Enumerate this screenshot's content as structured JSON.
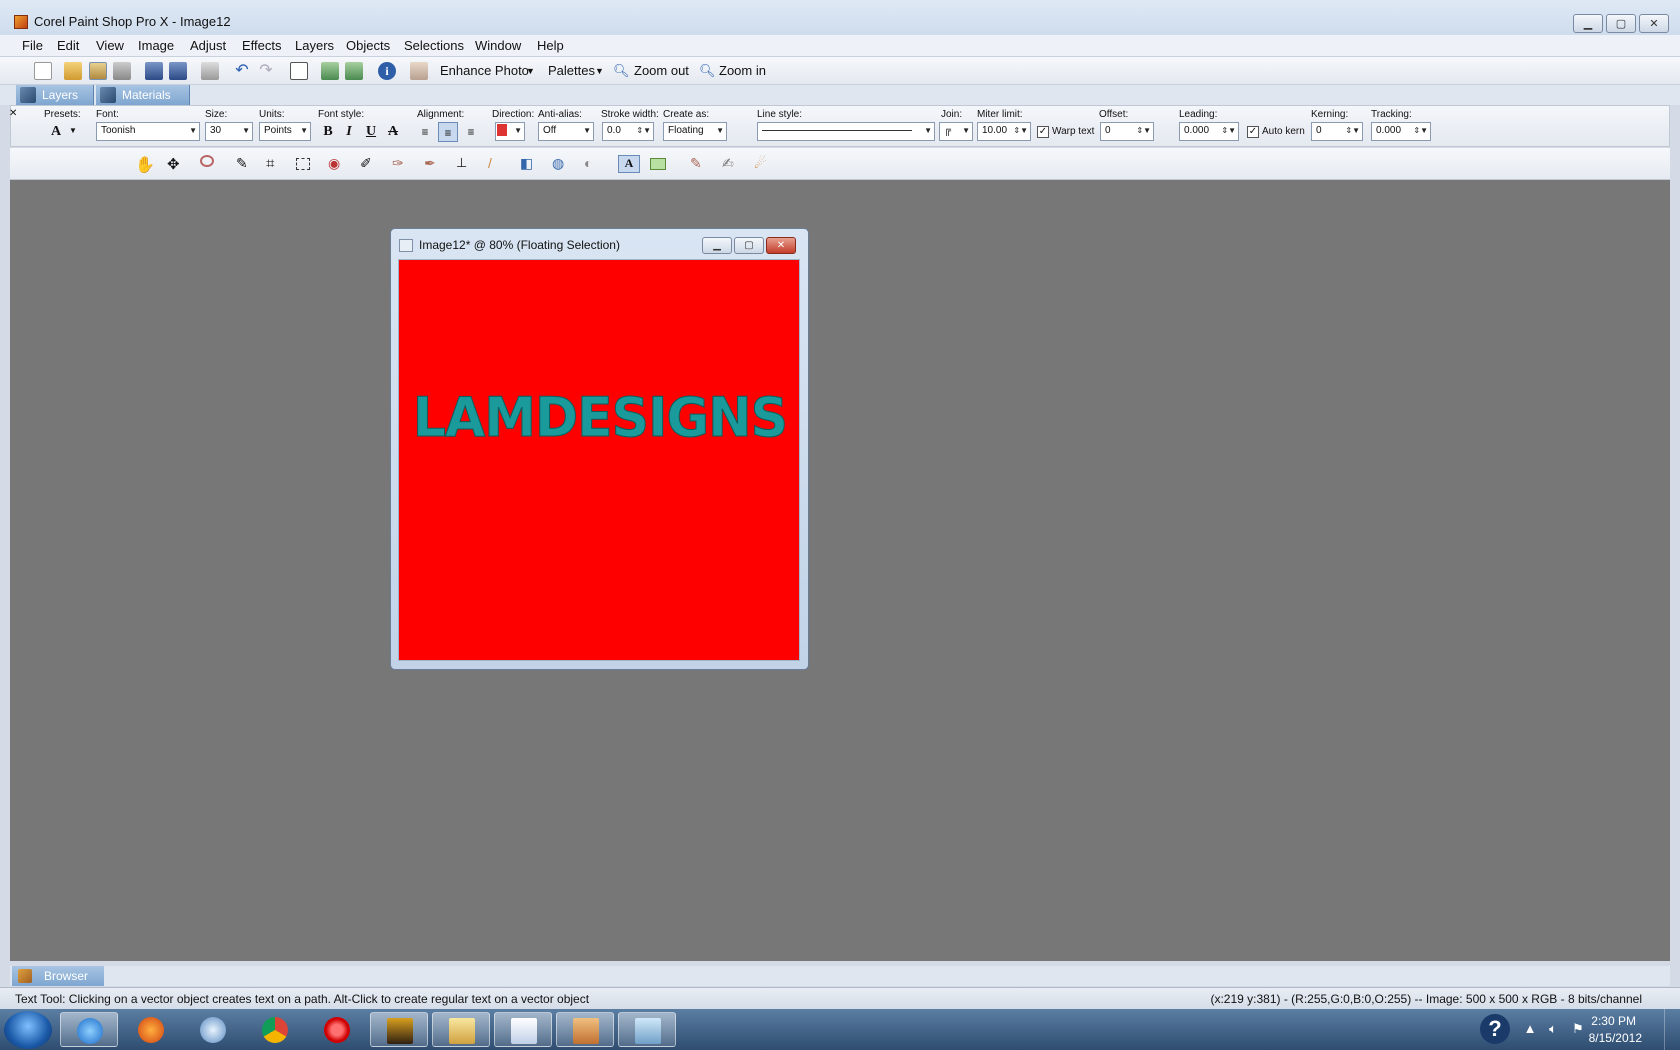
{
  "app": {
    "title": "Corel Paint Shop Pro X - Image12"
  },
  "window_controls": {
    "minimize": "▁",
    "maximize": "▢",
    "close": "✕"
  },
  "menu": [
    "File",
    "Edit",
    "View",
    "Image",
    "Adjust",
    "Effects",
    "Layers",
    "Objects",
    "Selections",
    "Window",
    "Help"
  ],
  "toolbar": {
    "enhance_photo": "Enhance Photo",
    "palettes": "Palettes",
    "zoom_out": "Zoom out",
    "zoom_in": "Zoom in"
  },
  "palette_tabs": [
    "Layers",
    "Materials"
  ],
  "tool_options": {
    "presets_label": "Presets:",
    "font_label": "Font:",
    "font_value": "Toonish",
    "size_label": "Size:",
    "size_value": "30",
    "units_label": "Units:",
    "units_value": "Points",
    "font_style_label": "Font style:",
    "alignment_label": "Alignment:",
    "direction_label": "Direction:",
    "antialias_label": "Anti-alias:",
    "antialias_value": "Off",
    "stroke_label": "Stroke width:",
    "stroke_value": "0.0",
    "create_label": "Create as:",
    "create_value": "Floating",
    "line_style_label": "Line style:",
    "join_label": "Join:",
    "miter_label": "Miter limit:",
    "miter_value": "10.00",
    "warp_text": "Warp text",
    "offset_label": "Offset:",
    "offset_value": "0",
    "leading_label": "Leading:",
    "leading_value": "0.000",
    "auto_kern": "Auto kern",
    "kerning_label": "Kerning:",
    "kerning_value": "0",
    "tracking_label": "Tracking:",
    "tracking_value": "0.000"
  },
  "image_window": {
    "title": "Image12* @  80% (Floating Selection)",
    "canvas_text": "LAMDESIGNS",
    "canvas_color": "#ff0000",
    "text_color": "#1a9a9a"
  },
  "browser_tab": "Browser",
  "status": {
    "left": "Text Tool: Clicking on a vector object creates text on a path. Alt-Click to create regular text on a vector object",
    "right": "(x:219 y:381) - (R:255,G:0,B:0,O:255) -- Image:  500 x 500 x RGB - 8 bits/channel"
  },
  "taskbar": {
    "time": "2:30 PM",
    "date": "8/15/2012",
    "help": "?"
  }
}
